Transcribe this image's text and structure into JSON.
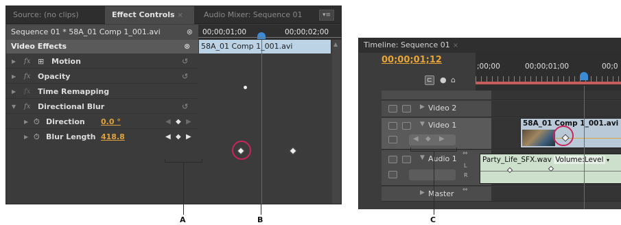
{
  "effect_controls": {
    "tabs": [
      {
        "label": "Source: (no clips)",
        "active": false
      },
      {
        "label": "Effect Controls",
        "active": true,
        "close": "×"
      },
      {
        "label": "Audio Mixer: Sequence 01",
        "active": false
      }
    ],
    "sequence_label": "Sequence 01 * 58A_01 Comp 1_001.avi",
    "ruler": {
      "tc1": "00;00;01;00",
      "tc2": "00;00;02;00"
    },
    "clip_name": "58A_01 Comp 1_001.avi",
    "video_effects_label": "Video Effects",
    "rows": {
      "motion": "Motion",
      "opacity": "Opacity",
      "time_remapping": "Time Remapping",
      "directional_blur": "Directional Blur",
      "direction": {
        "label": "Direction",
        "value": "0.0 °"
      },
      "blur_length": {
        "label": "Blur Length",
        "value": "418.8"
      }
    }
  },
  "timeline": {
    "tab_label": "Timeline: Sequence 01",
    "timecode": "00;00;01;12",
    "ruler": {
      "tc0": ";00;00",
      "tc1": "00;00;01;00",
      "tc2": "00;0"
    },
    "tracks": {
      "video2": "Video 2",
      "video1": "Video 1",
      "audio1": "Audio 1",
      "master": "Master"
    },
    "video_clip_name": "58A_01 Comp 1_001.avi",
    "audio_clip_name": "Party_Life_SFX.wav",
    "audio_clip_property": "Volume:Level",
    "channel_l": "L",
    "channel_r": "R"
  },
  "callouts": {
    "a": "A",
    "b": "B",
    "c": "C"
  },
  "colors": {
    "timecode": "#e8a535",
    "playhead": "#d93a3a",
    "highlight_circle": "#c8265b",
    "clip_video": "#b9c9d8",
    "clip_audio": "#cce0cc"
  }
}
